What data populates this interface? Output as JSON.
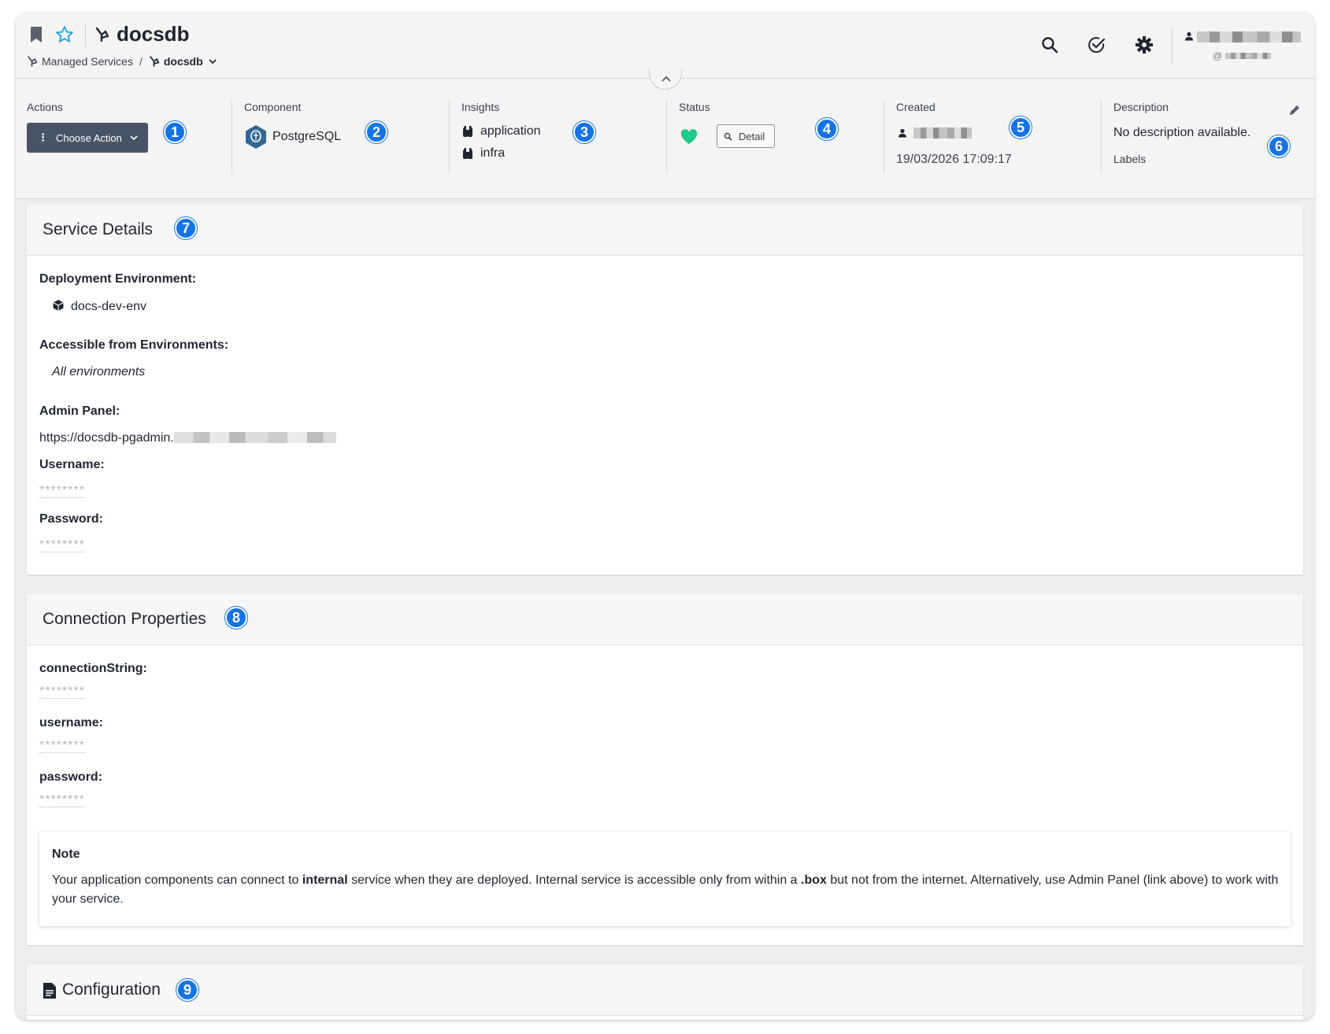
{
  "header": {
    "title": "docsdb",
    "breadcrumb": {
      "parent": "Managed Services",
      "separator": "/",
      "current": "docsdb"
    },
    "icons": [
      "bookmark-icon",
      "star-icon",
      "service-icon",
      "search-icon",
      "check-circle-icon",
      "gear-icon"
    ],
    "user": {
      "handle_prefix": "@"
    }
  },
  "info": {
    "actions": {
      "label": "Actions",
      "button_label": "Choose Action",
      "badge": "1"
    },
    "component": {
      "label": "Component",
      "value": "PostgreSQL",
      "badge": "2"
    },
    "insights": {
      "label": "Insights",
      "items": [
        "application",
        "infra"
      ],
      "badge": "3"
    },
    "status": {
      "label": "Status",
      "detail_button": "Detail",
      "health_color": "#1fc98a",
      "badge": "4"
    },
    "created": {
      "label": "Created",
      "date": "19/03/2026 17:09:17",
      "badge": "5"
    },
    "description": {
      "label": "Description",
      "value": "No description available.",
      "labels_label": "Labels",
      "badge": "6"
    }
  },
  "service_details": {
    "title": "Service Details",
    "badge": "7",
    "deployment_env_label": "Deployment Environment:",
    "deployment_env_value": "docs-dev-env",
    "accessible_label": "Accessible from Environments:",
    "accessible_value": "All environments",
    "admin_panel_label": "Admin Panel:",
    "admin_panel_url": "https://docsdb-pgadmin.",
    "username_label": "Username:",
    "username_value": "********",
    "password_label": "Password:",
    "password_value": "********"
  },
  "connection_properties": {
    "title": "Connection Properties",
    "badge": "8",
    "fields": [
      {
        "label": "connectionString:",
        "value": "********"
      },
      {
        "label": "username:",
        "value": "********"
      },
      {
        "label": "password:",
        "value": "********"
      }
    ],
    "note": {
      "title": "Note",
      "text_1": "Your application components can connect to ",
      "bold_1": "internal",
      "text_2": " service when they are deployed. Internal service is accessible only from within a ",
      "bold_2": ".box",
      "text_3": " but not from the internet. Alternatively, use Admin Panel (link above) to work with your service."
    }
  },
  "configuration": {
    "title": "Configuration",
    "badge": "9"
  },
  "colors": {
    "accent_blue": "#1473e6",
    "action_button_bg": "#4a5366",
    "health_green": "#1fc98a"
  }
}
